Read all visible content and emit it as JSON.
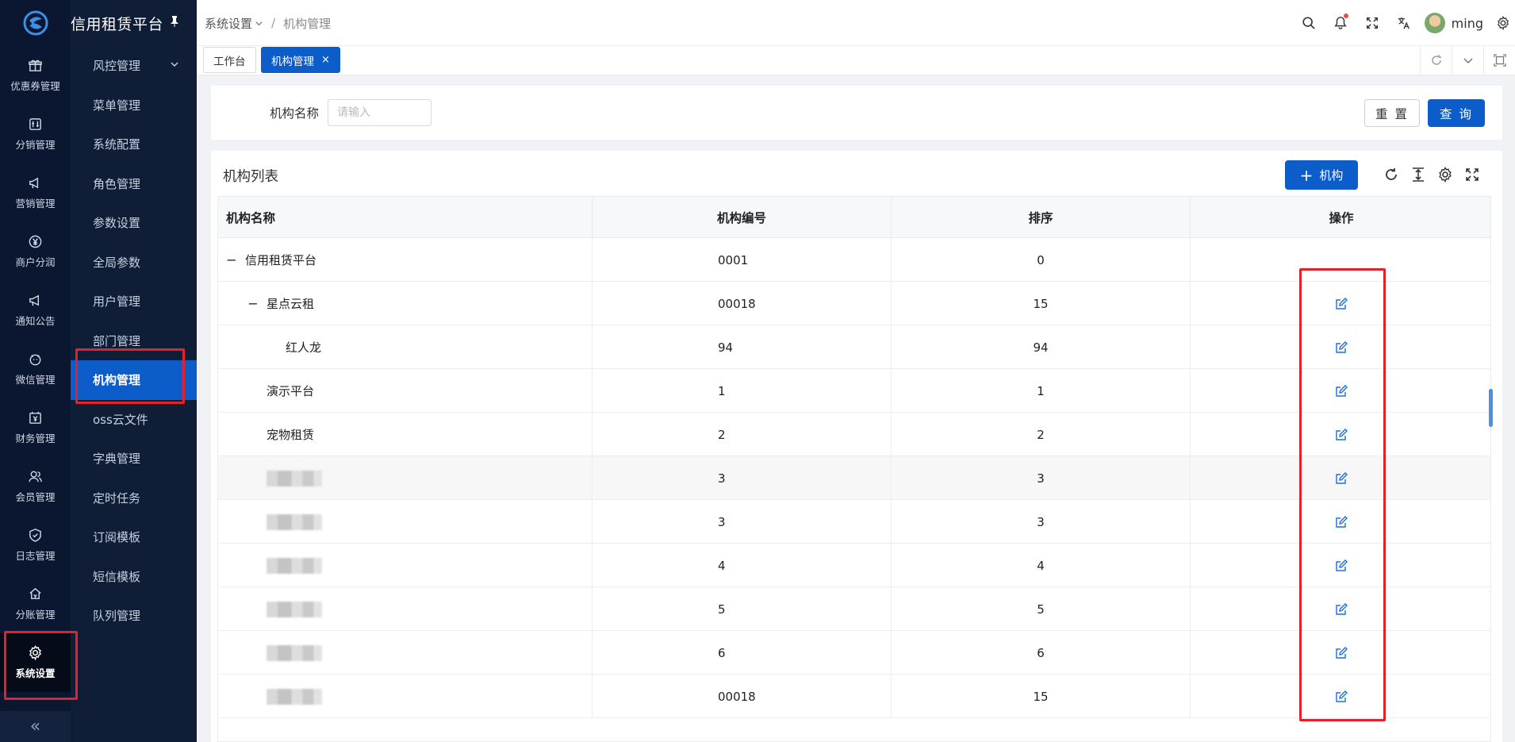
{
  "app": {
    "title": "信用租赁平台"
  },
  "rail": {
    "items": [
      {
        "label": "优惠券管理",
        "icon": "gift-icon"
      },
      {
        "label": "分销管理",
        "icon": "sliders-icon"
      },
      {
        "label": "营销管理",
        "icon": "megaphone-icon"
      },
      {
        "label": "商户分润",
        "icon": "yen-circle-icon"
      },
      {
        "label": "通知公告",
        "icon": "announcement-icon"
      },
      {
        "label": "微信管理",
        "icon": "wechat-icon"
      },
      {
        "label": "财务管理",
        "icon": "finance-icon"
      },
      {
        "label": "会员管理",
        "icon": "members-icon"
      },
      {
        "label": "日志管理",
        "icon": "shield-check-icon"
      },
      {
        "label": "分账管理",
        "icon": "split-account-icon"
      },
      {
        "label": "系统设置",
        "icon": "gear-icon",
        "active": true
      }
    ],
    "collapse_label": "«"
  },
  "submenu": {
    "items": [
      {
        "label": "风控管理",
        "has_children": true
      },
      {
        "label": "菜单管理"
      },
      {
        "label": "系统配置"
      },
      {
        "label": "角色管理"
      },
      {
        "label": "参数设置"
      },
      {
        "label": "全局参数"
      },
      {
        "label": "用户管理"
      },
      {
        "label": "部门管理"
      },
      {
        "label": "机构管理",
        "active": true
      },
      {
        "label": "oss云文件"
      },
      {
        "label": "字典管理"
      },
      {
        "label": "定时任务"
      },
      {
        "label": "订阅模板"
      },
      {
        "label": "短信模板"
      },
      {
        "label": "队列管理"
      }
    ]
  },
  "header": {
    "breadcrumb": [
      "系统设置",
      "机构管理"
    ],
    "username": "ming",
    "icons": [
      "search-icon",
      "bell-icon",
      "fullscreen-icon",
      "translate-icon",
      "gear-icon"
    ]
  },
  "tabs": [
    {
      "label": "工作台"
    },
    {
      "label": "机构管理",
      "active": true,
      "close": "×"
    }
  ],
  "search": {
    "label": "机构名称",
    "placeholder": "请输入",
    "value": "",
    "reset_label": "重 置",
    "query_label": "查 询"
  },
  "table": {
    "title": "机构列表",
    "add_label": "机构",
    "columns": [
      "机构名称",
      "机构编号",
      "排序",
      "操作"
    ],
    "rows": [
      {
        "name": "信用租赁平台",
        "code": "0001",
        "sort": "0",
        "level": 0,
        "toggle": "−",
        "edit": false
      },
      {
        "name": "星点云租",
        "code": "00018",
        "sort": "15",
        "level": 1,
        "toggle": "−",
        "edit": true
      },
      {
        "name": "红人龙",
        "code": "94",
        "sort": "94",
        "level": 2,
        "edit": true
      },
      {
        "name": "演示平台",
        "code": "1",
        "sort": "1",
        "level": 1,
        "edit": true
      },
      {
        "name": "宠物租赁",
        "code": "2",
        "sort": "2",
        "level": 1,
        "edit": true
      },
      {
        "name": "",
        "code": "3",
        "sort": "3",
        "level": 1,
        "blurred": true,
        "edit": true,
        "highlight": true
      },
      {
        "name": "",
        "code": "3",
        "sort": "3",
        "level": 1,
        "blurred": true,
        "edit": true
      },
      {
        "name": "",
        "code": "4",
        "sort": "4",
        "level": 1,
        "blurred": true,
        "edit": true
      },
      {
        "name": "",
        "code": "5",
        "sort": "5",
        "level": 1,
        "blurred": true,
        "edit": true
      },
      {
        "name": "",
        "code": "6",
        "sort": "6",
        "level": 1,
        "blurred": true,
        "edit": true
      },
      {
        "name": "",
        "code": "00018",
        "sort": "15",
        "level": 1,
        "blurred": true,
        "edit": true
      }
    ]
  },
  "colors": {
    "accent": "#0c5cc9",
    "rail_bg": "#0b1730",
    "submenu_bg": "#0f1d36",
    "annotation": "#e4202a"
  }
}
